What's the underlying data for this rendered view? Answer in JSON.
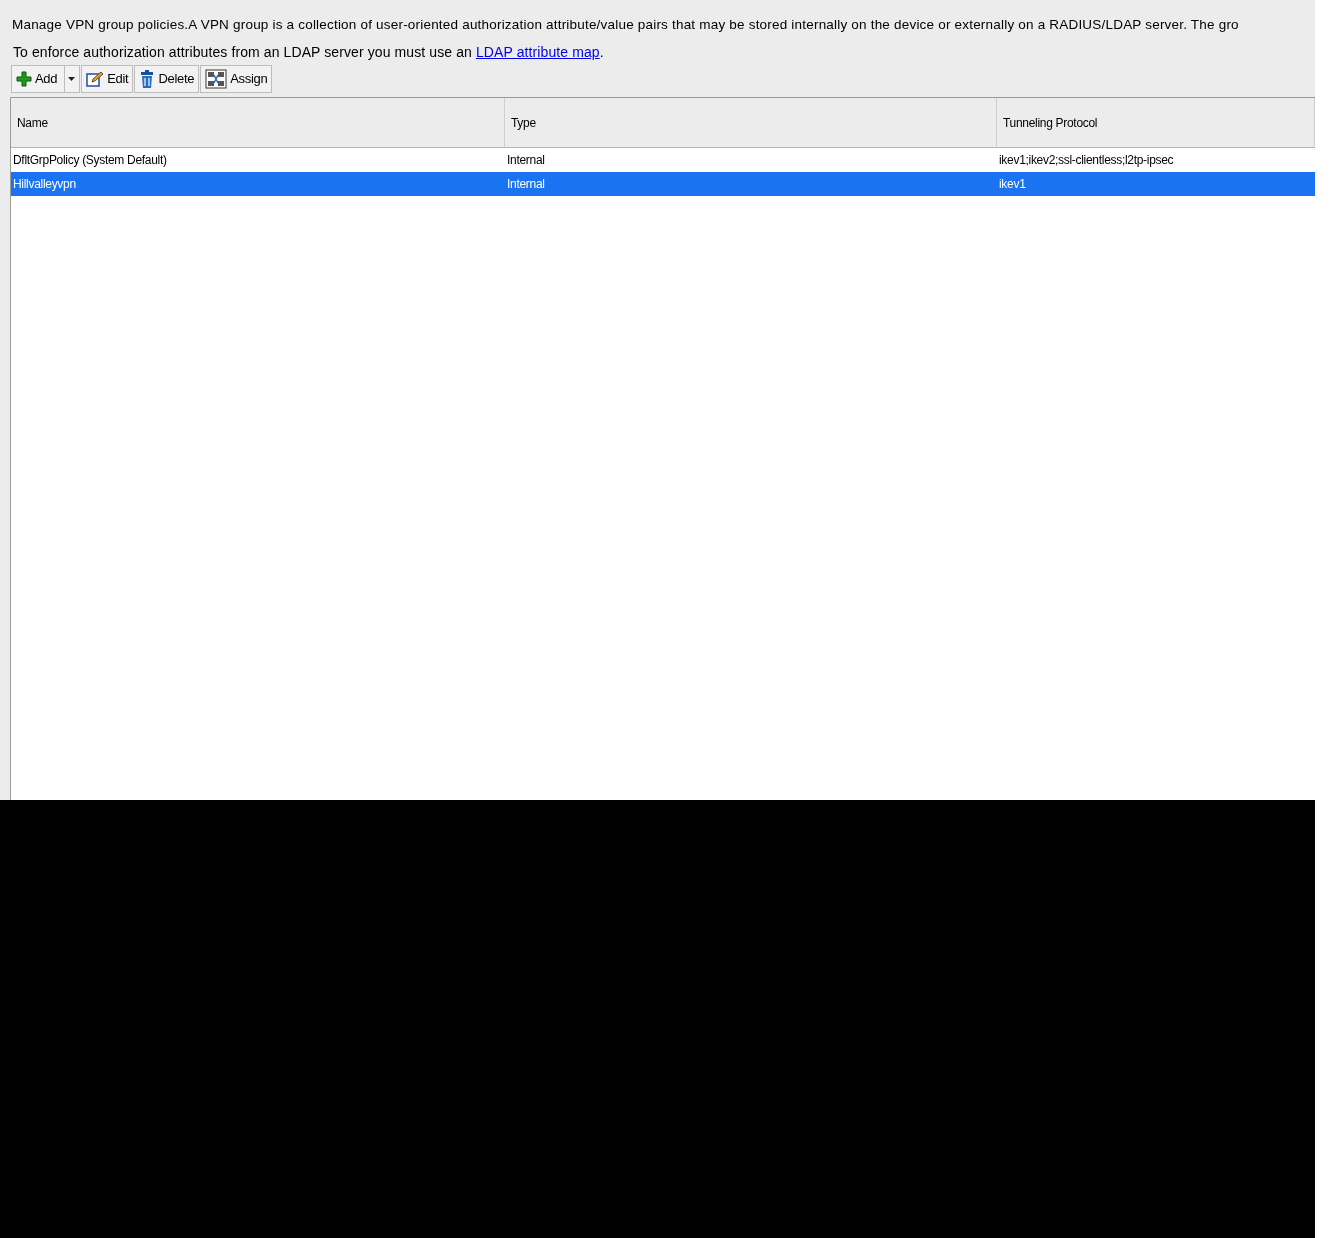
{
  "description": "Manage VPN group policies.A VPN group is a collection of user-oriented authorization attribute/value pairs that may be stored internally on the device or externally on a RADIUS/LDAP server. The gro",
  "ldap_note": {
    "text": "To enforce authorization attributes from an LDAP server you must use an",
    "link": "LDAP attribute map",
    "after": "."
  },
  "toolbar": [
    {
      "kind": "add",
      "label": "Add",
      "dropdown": true
    },
    {
      "kind": "edit",
      "label": "Edit",
      "dropdown": false
    },
    {
      "kind": "delete",
      "label": "Delete",
      "dropdown": false
    },
    {
      "kind": "assign",
      "label": "Assign",
      "dropdown": false
    }
  ],
  "table": {
    "columns": [
      "Name",
      "Type",
      "Tunneling Protocol"
    ],
    "rows": [
      {
        "cells": [
          "DfltGrpPolicy (System Default)",
          "Internal",
          "ikev1;ikev2;ssl-clientless;l2tp-ipsec"
        ],
        "selected": false
      },
      {
        "cells": [
          "Hillvalleyvpn",
          "Internal",
          "ikev1"
        ],
        "selected": true
      }
    ]
  }
}
